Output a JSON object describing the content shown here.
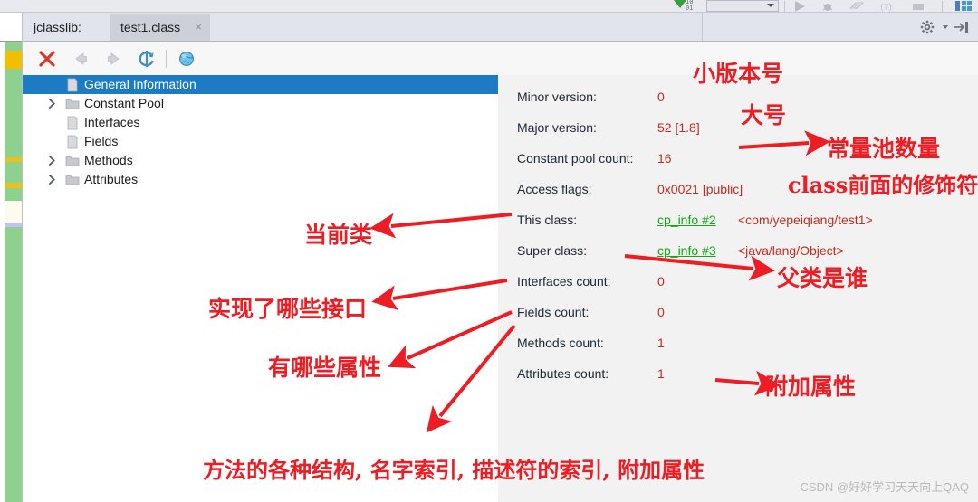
{
  "window": {
    "ide_topbar": {
      "error_count_top": "10",
      "error_count_bottom": "01",
      "run_config_placeholder": ""
    }
  },
  "tabbar": {
    "prefix_label": "jclasslib:",
    "active_tab_label": "test1.class",
    "close_glyph": "×",
    "gear_icon": "gear-icon",
    "collapse_icon": "collapse-all-icon"
  },
  "toolbar": {
    "items": [
      {
        "name": "close-icon",
        "tip": "Close"
      },
      {
        "name": "back-arrow-icon",
        "tip": "Back"
      },
      {
        "name": "forward-arrow-icon",
        "tip": "Forward"
      },
      {
        "name": "reload-icon",
        "tip": "Reload"
      },
      {
        "name": "browse-globe-icon",
        "tip": "Browse"
      }
    ]
  },
  "tree": {
    "items": [
      {
        "label": "General Information",
        "icon": "file-icon",
        "expandable": false,
        "selected": true
      },
      {
        "label": "Constant Pool",
        "icon": "folder-icon",
        "expandable": true,
        "selected": false
      },
      {
        "label": "Interfaces",
        "icon": "file-icon",
        "expandable": false,
        "selected": false
      },
      {
        "label": "Fields",
        "icon": "file-icon",
        "expandable": false,
        "selected": false
      },
      {
        "label": "Methods",
        "icon": "folder-icon",
        "expandable": true,
        "selected": false
      },
      {
        "label": "Attributes",
        "icon": "folder-icon",
        "expandable": true,
        "selected": false
      }
    ]
  },
  "detail": {
    "rows": [
      {
        "label": "Minor version:",
        "value": "0",
        "link": "",
        "extra": ""
      },
      {
        "label": "Major version:",
        "value": "52 [1.8]",
        "link": "",
        "extra": ""
      },
      {
        "label": "Constant pool count:",
        "value": "16",
        "link": "",
        "extra": ""
      },
      {
        "label": "Access flags:",
        "value": "0x0021 [public]",
        "link": "",
        "extra": ""
      },
      {
        "label": "This class:",
        "value": "",
        "link": "cp_info #2",
        "extra": "<com/yepeiqiang/test1>"
      },
      {
        "label": "Super class:",
        "value": "",
        "link": "cp_info #3",
        "extra": "<java/lang/Object>"
      },
      {
        "label": "Interfaces count:",
        "value": "0",
        "link": "",
        "extra": ""
      },
      {
        "label": "Fields count:",
        "value": "0",
        "link": "",
        "extra": ""
      },
      {
        "label": "Methods count:",
        "value": "1",
        "link": "",
        "extra": ""
      },
      {
        "label": "Attributes count:",
        "value": "1",
        "link": "",
        "extra": ""
      }
    ]
  },
  "annotations": {
    "minor_version": "小版本号",
    "major_version": "大号",
    "constant_pool": "常量池数量",
    "access_flags": "class前面的修饰符",
    "this_class": "当前类",
    "interfaces": "实现了哪些接口",
    "fields": "有哪些属性",
    "super_class": "父类是谁",
    "attributes": "附加属性",
    "methods": "方法的各种结构, 名字索引, 描述符的索引, 附加属性"
  },
  "watermark": {
    "text": "CSDN @好好学习天天向上QAQ"
  },
  "colors": {
    "accent_selection": "#1d7bc4",
    "value_red": "#c42b1c",
    "link_green": "#13a813",
    "annotation_red": "#ee1c23",
    "panel_bg": "#f2f2f2",
    "tree_bg": "#ffffff"
  }
}
